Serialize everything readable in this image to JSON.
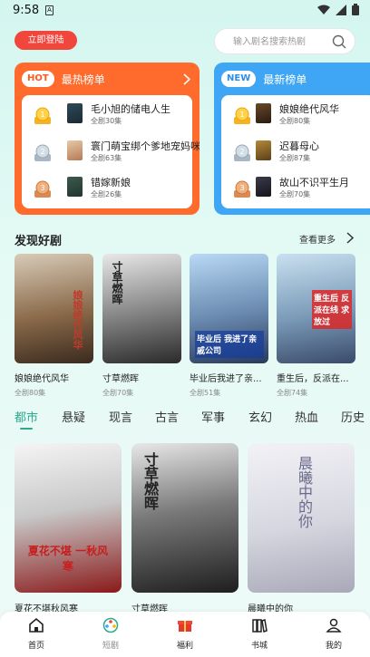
{
  "status": {
    "time": "9:58"
  },
  "header": {
    "login_label": "立即登陆",
    "search_placeholder": "输入剧名搜索热剧"
  },
  "hot_rank": {
    "badge": "HOT",
    "title": "最热榜单",
    "items": [
      {
        "rank": "1",
        "name": "毛小旭的储电人生",
        "count": "全剧30集"
      },
      {
        "rank": "2",
        "name": "寰门萌宝绑个爹地宠妈咪",
        "count": "全剧63集"
      },
      {
        "rank": "3",
        "name": "错嫁新娘",
        "count": "全剧26集"
      }
    ]
  },
  "new_rank": {
    "badge": "NEW",
    "title": "最新榜单",
    "items": [
      {
        "rank": "1",
        "name": "娘娘绝代风华",
        "count": "全剧80集"
      },
      {
        "rank": "2",
        "name": "迟暮母心",
        "count": "全剧87集"
      },
      {
        "rank": "3",
        "name": "故山不识平生月",
        "count": "全剧70集"
      }
    ]
  },
  "discover": {
    "title": "发现好剧",
    "more_label": "查看更多",
    "items": [
      {
        "title": "娘娘绝代风华",
        "count": "全剧80集",
        "poster_text": "娘娘绝代风华"
      },
      {
        "title": "寸草燃晖",
        "count": "全剧70集",
        "poster_text": "寸草燃晖"
      },
      {
        "title": "毕业后我进了亲...",
        "count": "全剧51集",
        "poster_text": "毕业后 我进了亲戚公司"
      },
      {
        "title": "重生后，反派在...",
        "count": "全剧74集",
        "poster_text": "重生后 反派在线 求放过"
      }
    ]
  },
  "categories": [
    "都市",
    "悬疑",
    "现言",
    "古言",
    "军事",
    "玄幻",
    "热血",
    "历史"
  ],
  "grid": {
    "items": [
      {
        "title": "夏花不堪秋风寒",
        "poster_text": "夏花不堪 一秋风寒"
      },
      {
        "title": "寸草燃晖",
        "poster_text": "寸草燃晖"
      },
      {
        "title": "晨曦中的你",
        "poster_text": "晨曦中的你"
      }
    ]
  },
  "tabbar": {
    "tabs": [
      {
        "label": "首页"
      },
      {
        "label": "短剧"
      },
      {
        "label": "福利"
      },
      {
        "label": "书城"
      },
      {
        "label": "我的"
      }
    ]
  },
  "colors": {
    "accent": "#2ea88e",
    "hot": "#ff6b2c",
    "new": "#3fa5f5",
    "login": "#f0463c"
  }
}
